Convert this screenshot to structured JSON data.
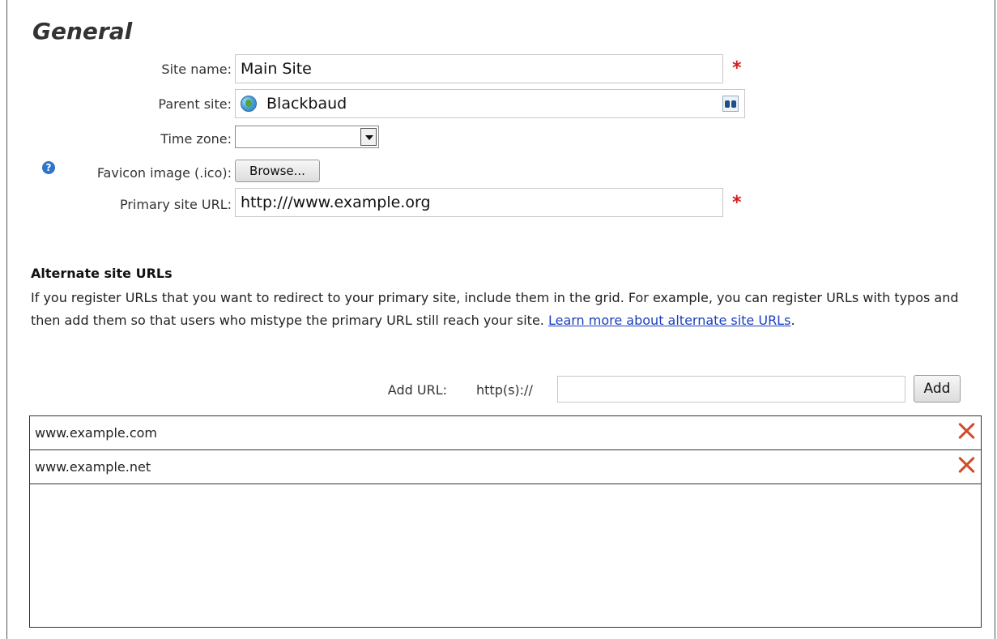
{
  "general": {
    "title": "General",
    "site_name": {
      "label": "Site name:",
      "value": "Main Site"
    },
    "parent_site": {
      "label": "Parent site:",
      "value": "Blackbaud"
    },
    "time_zone": {
      "label": "Time zone:",
      "value": ""
    },
    "favicon": {
      "label": "Favicon image (.ico):",
      "button": "Browse..."
    },
    "primary_url": {
      "label": "Primary site URL:",
      "value": "http:///www.example.org"
    },
    "required_mark": "*"
  },
  "alternate": {
    "heading": "Alternate site URLs",
    "description": "If you register URLs that you want to redirect to your primary site, include them in the grid. For example, you can register URLs with typos and then add them so that users who mistype the primary URL still reach your site. ",
    "link_text": "Learn more about alternate site URLs",
    "description_end": ".",
    "add_label": "Add URL:",
    "prefix": "http(s)://",
    "add_input_value": "",
    "add_button": "Add",
    "urls": [
      "www.example.com",
      "www.example.net"
    ]
  }
}
